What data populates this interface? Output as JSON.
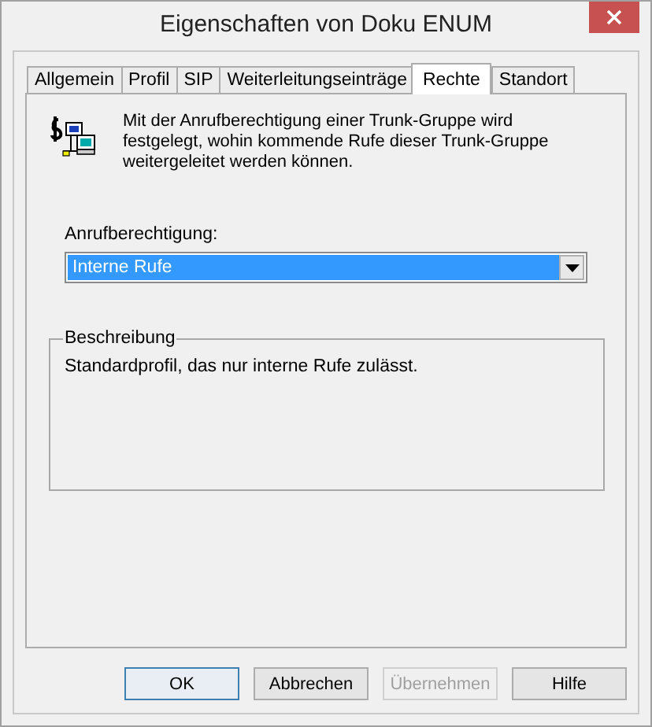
{
  "window": {
    "title": "Eigenschaften von Doku ENUM"
  },
  "tabs": [
    {
      "label": "Allgemein",
      "selected": false
    },
    {
      "label": "Profil",
      "selected": false
    },
    {
      "label": "SIP",
      "selected": false
    },
    {
      "label": "Weiterleitungseinträge",
      "selected": false
    },
    {
      "label": "Rechte",
      "selected": true
    },
    {
      "label": "Standort",
      "selected": false
    }
  ],
  "intro": "Mit der Anrufberechtigung einer Trunk-Gruppe wird festgelegt, wohin kommende Rufe dieser Trunk-Gruppe weitergeleitet werden können.",
  "permission": {
    "label": "Anrufberechtigung:",
    "value": "Interne Rufe",
    "selected": true
  },
  "description": {
    "title": "Beschreibung",
    "text": "Standardprofil, das nur interne Rufe zulässt."
  },
  "buttons": [
    {
      "label": "OK",
      "default": true,
      "disabled": false
    },
    {
      "label": "Abbrechen",
      "default": false,
      "disabled": false
    },
    {
      "label": "Übernehmen",
      "default": false,
      "disabled": true
    },
    {
      "label": "Hilfe",
      "default": false,
      "disabled": false
    }
  ]
}
